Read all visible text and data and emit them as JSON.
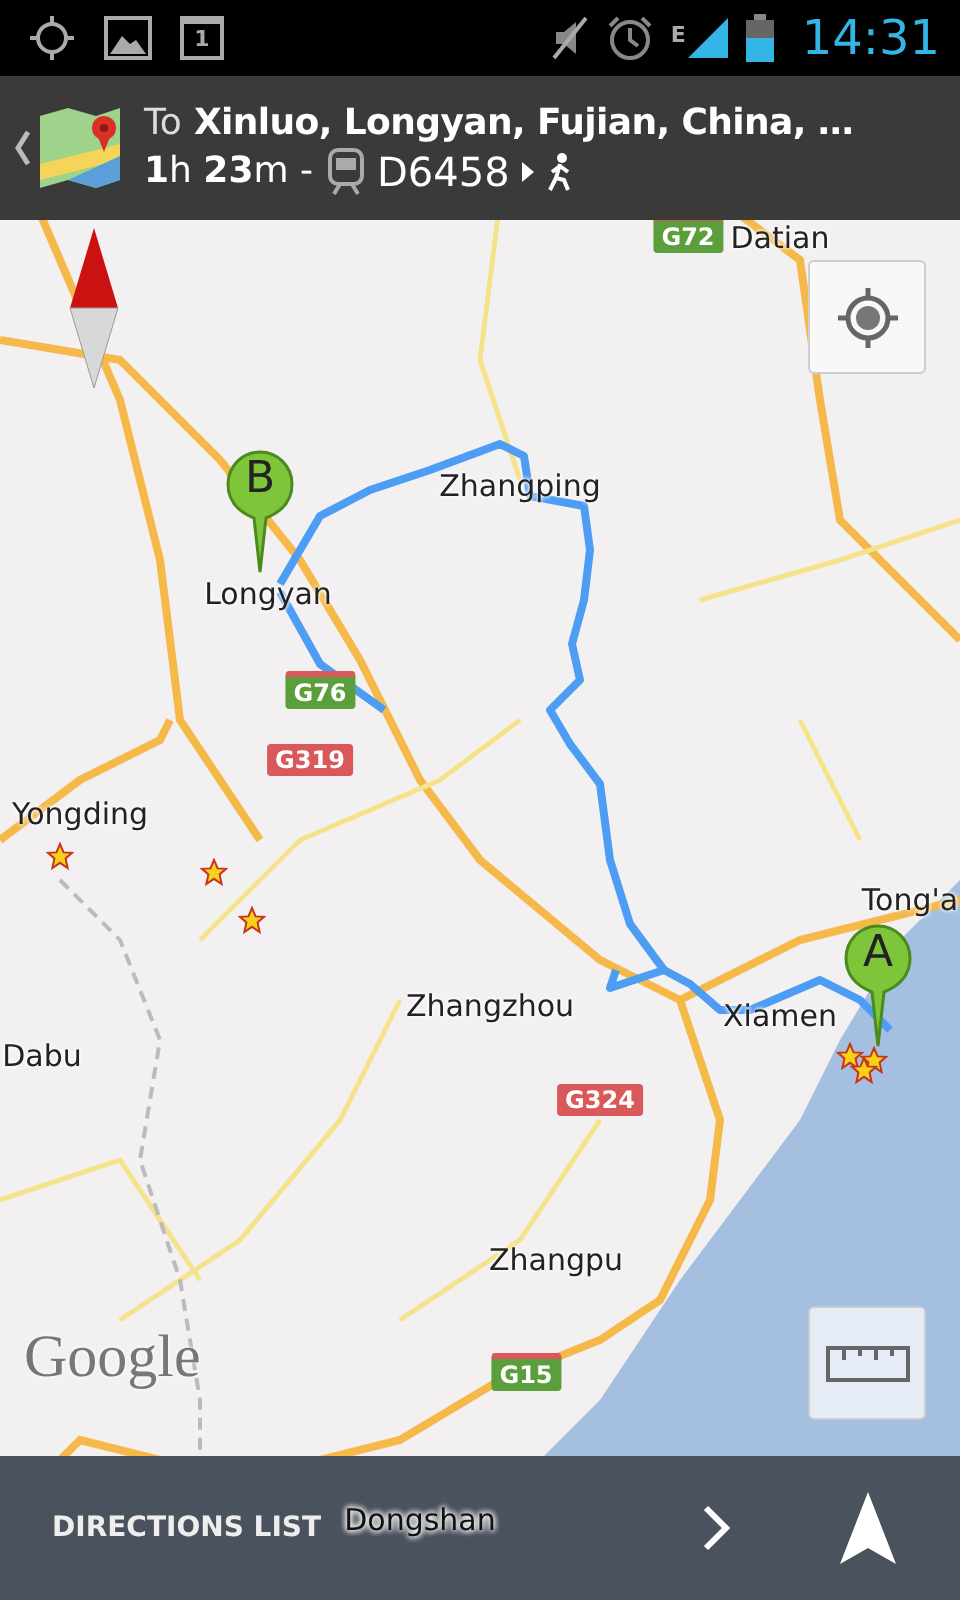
{
  "status_bar": {
    "calendar_day": "1",
    "network_type": "E",
    "time": "14:31"
  },
  "header": {
    "prefix": "To",
    "destination": "Xinluo, Longyan, Fujian, China, …",
    "duration": "**1**h **23**m -",
    "train": "D6458"
  },
  "map": {
    "places": [
      {
        "kind": "city",
        "name": "Datian"
      },
      {
        "kind": "city",
        "name": "Zhangping"
      },
      {
        "kind": "city",
        "name": "Longyan"
      },
      {
        "kind": "city",
        "name": "Yongding"
      },
      {
        "kind": "city",
        "name": "Dabu"
      },
      {
        "kind": "city",
        "name": "Tong'a"
      },
      {
        "kind": "city",
        "name": "Zhangzhou"
      },
      {
        "kind": "city",
        "name": "Xiamen"
      },
      {
        "kind": "city",
        "name": "Zhangpu"
      },
      {
        "kind": "city",
        "name": "Dongshan"
      },
      {
        "kind": "expressway",
        "name": "G72"
      },
      {
        "kind": "expressway",
        "name": "G76"
      },
      {
        "kind": "national",
        "name": "G319"
      },
      {
        "kind": "national",
        "name": "G324"
      },
      {
        "kind": "expressway",
        "name": "G15"
      }
    ],
    "markers": [
      {
        "label": "B"
      },
      {
        "label": "A"
      }
    ],
    "attribution": "Google"
  },
  "bottom_bar": {
    "directions_label": "DIRECTIONS LIST"
  }
}
